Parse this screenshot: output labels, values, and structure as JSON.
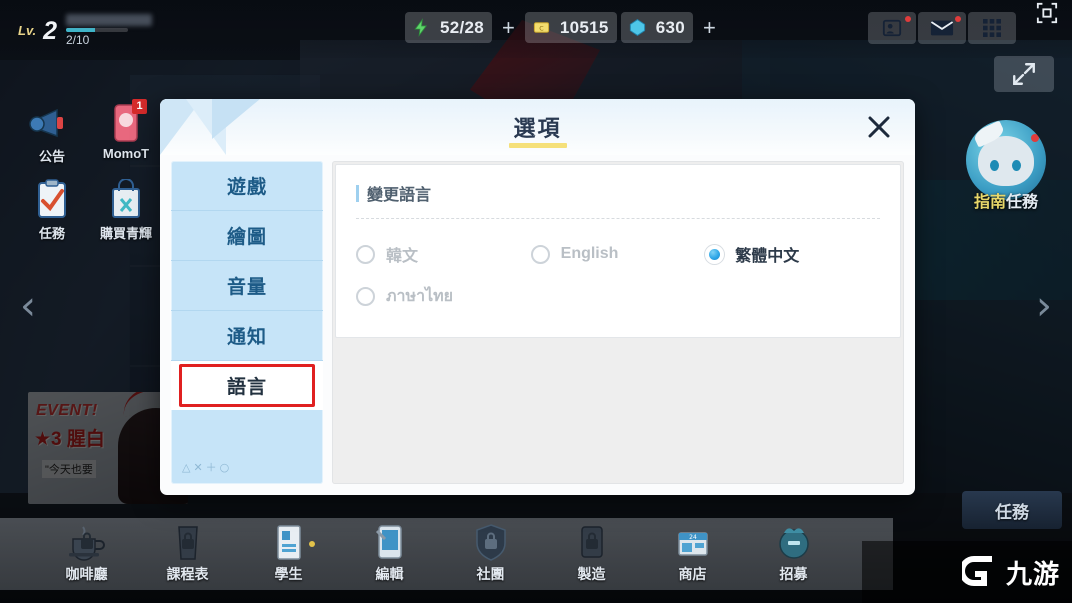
{
  "hud": {
    "level_prefix": "Lv.",
    "level": "2",
    "xp_text": "2/10",
    "currencies": [
      {
        "icon": "energy-icon",
        "value": "52/28",
        "has_plus": true
      },
      {
        "icon": "credit-icon",
        "value": "10515",
        "has_plus": false
      },
      {
        "icon": "gem-icon",
        "value": "630",
        "has_plus": true
      }
    ],
    "capture_icon": "screen-capture-icon",
    "contacts_icon": "contacts-icon",
    "mail_icon": "mail-icon",
    "grid_menu_icon": "grid-menu-icon",
    "expand_icon": "expand-arrows-icon"
  },
  "left_menu": [
    {
      "label": "公告",
      "icon": "megaphone-icon",
      "badge": ""
    },
    {
      "label": "MomoT",
      "icon": "phone-icon",
      "badge": "1"
    },
    {
      "label": "任務",
      "icon": "clipboard-icon",
      "badge": ""
    },
    {
      "label": "購買青輝",
      "icon": "shopping-bag-icon",
      "badge": ""
    }
  ],
  "event_banner": {
    "title": "EVENT!",
    "subtitle": "★3 腥白",
    "caption": "\"今天也要"
  },
  "guide": {
    "label_highlight": "指南",
    "label_rest": "任務"
  },
  "task_button": {
    "label": "任務"
  },
  "arrows": {
    "left": "‹",
    "right": "›"
  },
  "bottom_nav": [
    {
      "label": "咖啡廳",
      "icon": "coffee-cup-icon",
      "locked": true
    },
    {
      "label": "課程表",
      "icon": "schedule-icon",
      "locked": true
    },
    {
      "label": "學生",
      "icon": "student-card-icon",
      "locked": false
    },
    {
      "label": "編輯",
      "icon": "edit-tablet-icon",
      "locked": false
    },
    {
      "label": "社團",
      "icon": "club-shield-icon",
      "locked": true
    },
    {
      "label": "製造",
      "icon": "craft-icon",
      "locked": true
    },
    {
      "label": "商店",
      "icon": "shop-icon",
      "locked": false
    },
    {
      "label": "招募",
      "icon": "recruit-icon",
      "locked": false
    }
  ],
  "watermark": {
    "text": "九游",
    "logo_icon": "nine-game-logo-icon"
  },
  "dialog": {
    "title": "選項",
    "close_icon": "close-icon",
    "sidebar": {
      "items": [
        {
          "label": "遊戲",
          "active": false
        },
        {
          "label": "繪圖",
          "active": false
        },
        {
          "label": "音量",
          "active": false
        },
        {
          "label": "通知",
          "active": false
        },
        {
          "label": "語言",
          "active": true
        }
      ],
      "hints": "△✕＋○"
    },
    "content": {
      "section_title": "變更語言",
      "options": [
        {
          "label": "韓文",
          "selected": false
        },
        {
          "label": "English",
          "selected": false
        },
        {
          "label": "繁體中文",
          "selected": true
        },
        {
          "label": "ภาษาไทย",
          "selected": false
        }
      ]
    }
  },
  "colors": {
    "accent_blue": "#c6e4f8",
    "sidebar_text": "#1d5b87",
    "highlight_red": "#e02020",
    "title_underline": "#f5e07a",
    "radio_selected": "#2fa7e8"
  }
}
